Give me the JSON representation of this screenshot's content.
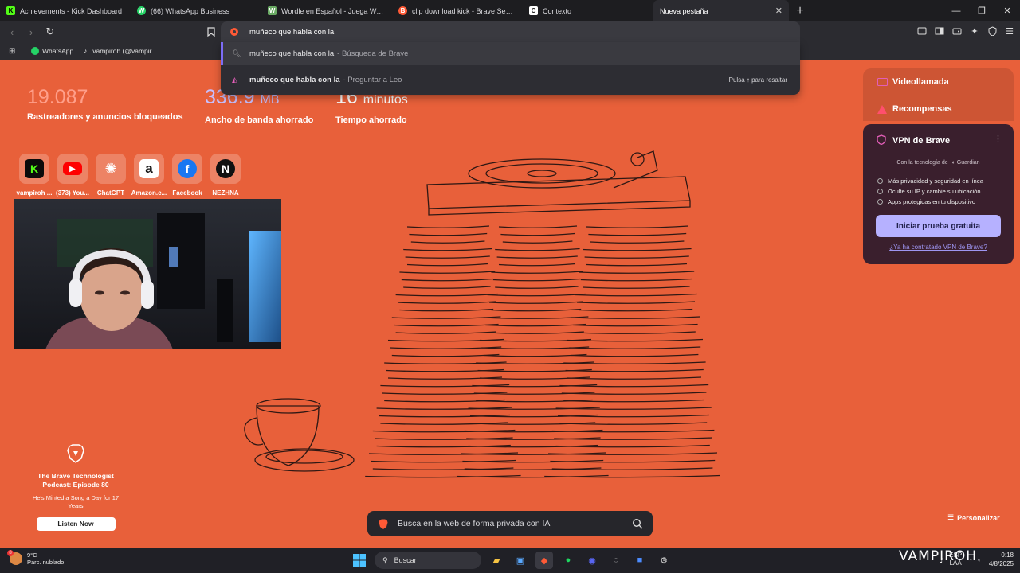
{
  "tabs": [
    {
      "title": "Achievements - Kick Dashboard",
      "favicon": "K",
      "color": "#53fc18",
      "active": false
    },
    {
      "title": "(66) WhatsApp Business",
      "favicon": "W",
      "color": "#25d366",
      "active": false
    },
    {
      "title": "Wordle en Español - Juega Wordle c",
      "favicon": "W",
      "color": "#6aaa64",
      "active": false
    },
    {
      "title": "clip download kick - Brave Search",
      "favicon": "B",
      "color": "#ff5a36",
      "active": false
    },
    {
      "title": "Contexto",
      "favicon": "C",
      "color": "#ffffff",
      "active": false
    },
    {
      "title": "Nueva pestaña",
      "favicon": "",
      "color": "",
      "active": true
    }
  ],
  "omnibox": {
    "query": "muñeco que habla con la"
  },
  "suggestions": [
    {
      "text": "muñeco que habla con la",
      "suffix": "- Búsqueda de Brave",
      "icon": "search-icon",
      "hint": ""
    },
    {
      "text": "muñeco que habla con la",
      "suffix": "- Preguntar a Leo",
      "icon": "leo-icon",
      "hint": "Pulsa ↑ para resaltar"
    }
  ],
  "bookmarks": [
    {
      "label": "WhatsApp",
      "icon": "whatsapp-icon",
      "color": "#25d366"
    },
    {
      "label": "vampiroh (@vampir...",
      "icon": "tiktok-icon",
      "color": "#ffffff"
    }
  ],
  "stats": [
    {
      "value": "19.087",
      "unit": "",
      "label": "Rastreadores y anuncios bloqueados",
      "color": "#ff9f8a"
    },
    {
      "value": "336.9",
      "unit": "MB",
      "label": "Ancho de banda ahorrado",
      "color": "#c7c0ff"
    },
    {
      "value": "16",
      "unit": "minutos",
      "label": "Tiempo ahorrado",
      "color": "#ffffff"
    }
  ],
  "top_sites": [
    {
      "label": "vampiroh ...",
      "glyph": "K",
      "bg": "#0b0b0b",
      "fg": "#53fc18"
    },
    {
      "label": "(373) You...",
      "glyph": "▶",
      "bg": "#ff0000",
      "fg": "#ffffff"
    },
    {
      "label": "ChatGPT",
      "glyph": "✺",
      "bg": "transparent",
      "fg": "#ffffff"
    },
    {
      "label": "Amazon.c...",
      "glyph": "a",
      "bg": "#ffffff",
      "fg": "#111111"
    },
    {
      "label": "Facebook",
      "glyph": "f",
      "bg": "#1877f2",
      "fg": "#ffffff"
    },
    {
      "label": "NEZHNA",
      "glyph": "N",
      "bg": "#111111",
      "fg": "#ffffff"
    }
  ],
  "widgets": {
    "video_call": "Videollamada",
    "rewards": "Recompensas",
    "vpn": {
      "title": "VPN de Brave",
      "tech": "Con la tecnología de",
      "tech_brand": "Guardian",
      "features": [
        "Más privacidad y seguridad en línea",
        "Oculte su IP y cambie su ubicación",
        "Apps protegidas en tu dispositivo"
      ],
      "cta": "Iniciar prueba gratuita",
      "link": "¿Ya ha contratado VPN de Brave?"
    }
  },
  "podcast": {
    "title": "The Brave Technologist Podcast: Episode 80",
    "subtitle": "He's Minted a Song a Day for 17 Years",
    "button": "Listen Now"
  },
  "ai_search": {
    "placeholder": "Busca en la web de forma privada con IA"
  },
  "personalize": "Personalizar",
  "taskbar": {
    "weather_temp": "9°C",
    "weather_desc": "Parc. nublado",
    "weather_badge": "8",
    "search": "Buscar",
    "lang_top": "ESP",
    "lang_bottom": "LAA",
    "time": "0:18",
    "date": "4/8/2025"
  },
  "watermark": "VAMPIROH"
}
